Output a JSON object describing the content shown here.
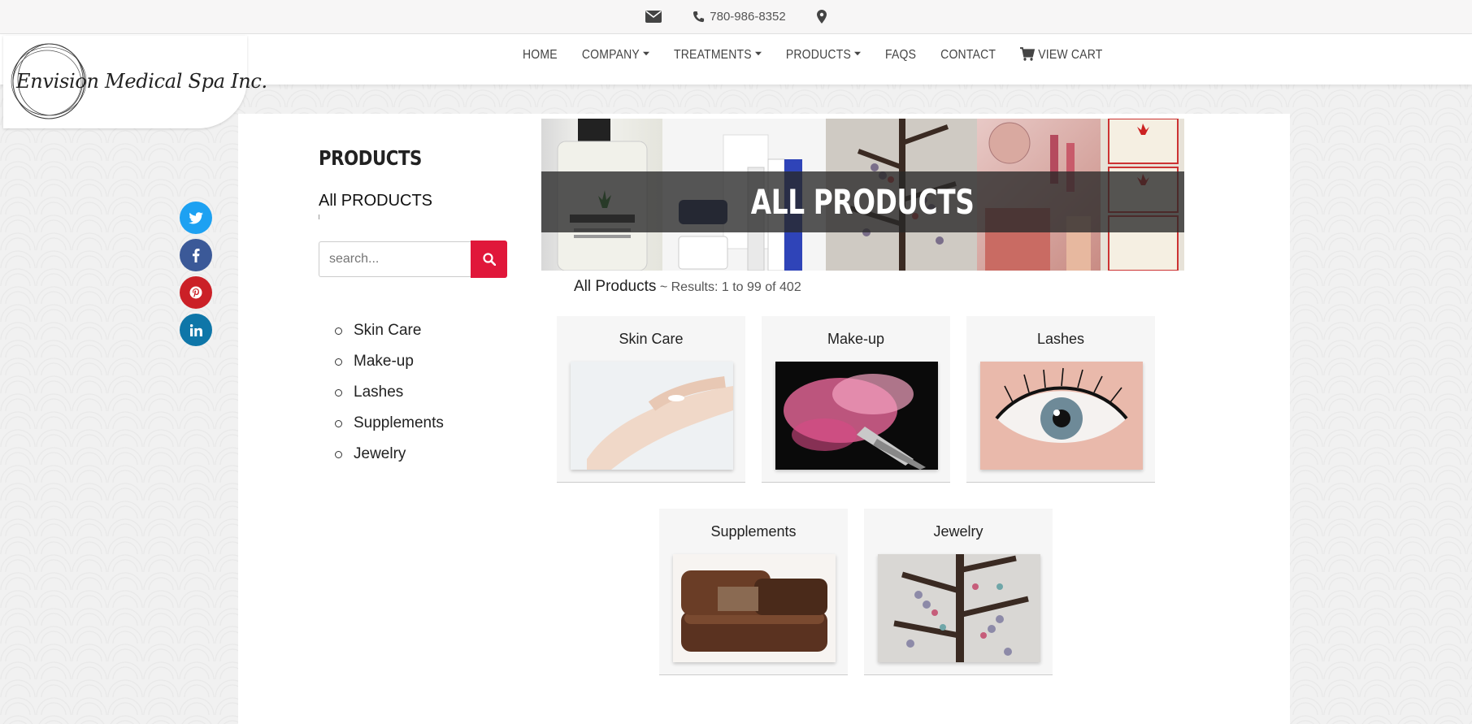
{
  "topbar": {
    "phone": "780-986-8352",
    "email_icon": "envelope-icon",
    "phone_icon": "phone-icon",
    "location_icon": "map-marker-icon"
  },
  "nav": {
    "home": "HOME",
    "company": "COMPANY",
    "treatments": "TREATMENTS",
    "products": "PRODUCTS",
    "faqs": "FAQS",
    "contact": "CONTACT",
    "cart": "VIEW CART"
  },
  "logo": {
    "text": "Envision Medical Spa Inc."
  },
  "sidebar": {
    "title": "PRODUCTS",
    "subtitle": "All PRODUCTS",
    "search_placeholder": "search...",
    "categories": [
      "Skin Care",
      "Make-up",
      "Lashes",
      "Supplements",
      "Jewelry"
    ]
  },
  "banner": {
    "title": "ALL PRODUCTS"
  },
  "results": {
    "heading": "All Products",
    "summary": " ~ Results: 1 to 99 of 402"
  },
  "tiles": [
    "Skin Care",
    "Make-up",
    "Lashes",
    "Supplements",
    "Jewelry"
  ],
  "colors": {
    "accent": "#e0173a",
    "twitter": "#1da1f2",
    "facebook": "#3b5998",
    "pinterest": "#cb2027",
    "linkedin": "#0e76a8"
  }
}
